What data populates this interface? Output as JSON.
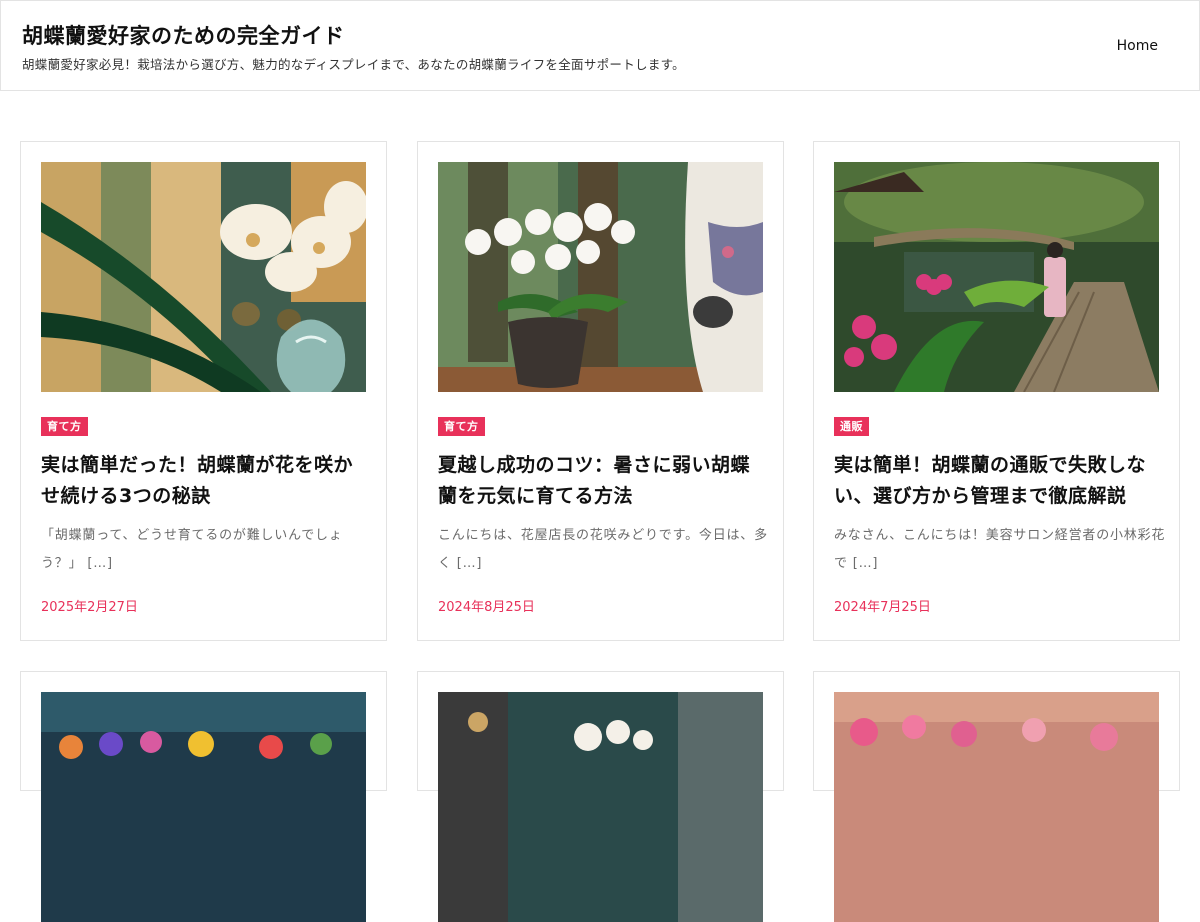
{
  "site": {
    "title": "胡蝶蘭愛好家のための完全ガイド",
    "description": "胡蝶蘭愛好家必見！栽培法から選び方、魅力的なディスプレイまで、あなたの胡蝶蘭ライフを全面サポートします。",
    "nav": {
      "home": "Home"
    }
  },
  "colors": {
    "accent": "#e8315a",
    "border": "#e3e3e3",
    "muted_text": "#6b6b6b"
  },
  "posts": [
    {
      "category": "育て方",
      "title": "実は簡単だった！胡蝶蘭が花を咲かせ続ける3つの秘訣",
      "excerpt": "「胡蝶蘭って、どうせ育てるのが難しいんでしょう？」 […]",
      "date": "2025年2月27日",
      "image": "white-orchid-glass-vase"
    },
    {
      "category": "育て方",
      "title": "夏越し成功のコツ：暑さに弱い胡蝶蘭を元気に育てる方法",
      "excerpt": "こんにちは、花屋店長の花咲みどりです。今日は、多く […]",
      "date": "2024年8月25日",
      "image": "potted-orchid-kimono-watering"
    },
    {
      "category": "通販",
      "title": "実は簡単！胡蝶蘭の通販で失敗しない、選び方から管理まで徹底解説",
      "excerpt": "みなさん、こんにちは！美容サロン経営者の小林彩花で […]",
      "date": "2024年7月25日",
      "image": "japanese-garden-orchids"
    },
    {
      "image": "colorful-orchids"
    },
    {
      "image": "white-orchids-teal"
    },
    {
      "image": "pink-orchids"
    }
  ]
}
